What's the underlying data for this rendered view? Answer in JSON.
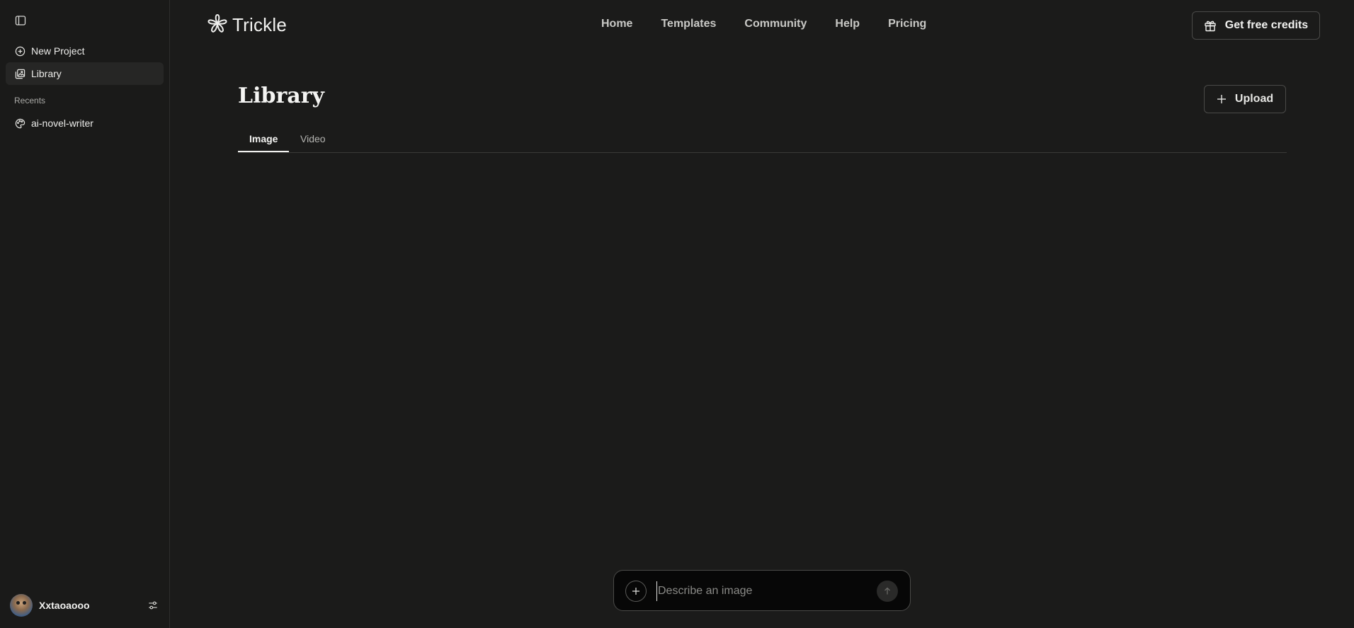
{
  "sidebar": {
    "toggle_icon": "sidebar-panel-icon",
    "items": [
      {
        "label": "New Project",
        "icon": "plus-circle-icon",
        "active": false
      },
      {
        "label": "Library",
        "icon": "images-icon",
        "active": true
      }
    ],
    "recents_label": "Recents",
    "recents": [
      {
        "label": "ai-novel-writer",
        "icon": "palette-icon"
      }
    ],
    "user": {
      "name": "Xxtaoaooo",
      "settings_icon": "sliders-icon"
    }
  },
  "header": {
    "brand": "Trickle",
    "nav": [
      "Home",
      "Templates",
      "Community",
      "Help",
      "Pricing"
    ],
    "credits_label": "Get free credits",
    "credits_icon": "gift-icon"
  },
  "main": {
    "title": "Library",
    "upload_label": "Upload",
    "tabs": [
      {
        "label": "Image",
        "active": true
      },
      {
        "label": "Video",
        "active": false
      }
    ]
  },
  "prompt": {
    "placeholder": "Describe an image",
    "value": ""
  },
  "colors": {
    "background": "#1b1b1a",
    "sidebar": "#1a1a19",
    "prompt_bg": "#070707",
    "text": "#e8e8e6",
    "border": "#4a4a48"
  }
}
